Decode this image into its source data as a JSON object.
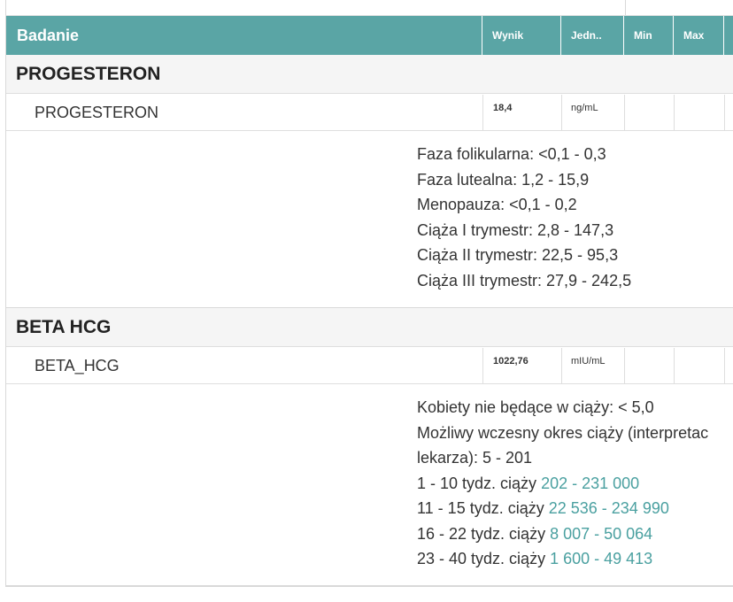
{
  "header": {
    "col_test": "Badanie",
    "col_result": "Wynik",
    "col_unit": "Jedn..",
    "col_min": "Min",
    "col_max": "Max"
  },
  "sections": [
    {
      "title": "PROGESTERON",
      "row": {
        "name": "PROGESTERON",
        "value": "18,4",
        "unit": "ng/mL"
      },
      "norms": [
        "Faza folikularna: <0,1 - 0,3",
        "Faza lutealna: 1,2 - 15,9",
        "Menopauza: <0,1 - 0,2",
        "Ciąża I trymestr: 2,8 - 147,3",
        "Ciąża II trymestr: 22,5 - 95,3",
        "Ciąża III trymestr: 27,9 - 242,5"
      ]
    },
    {
      "title": "BETA HCG",
      "row": {
        "name": "BETA_HCG",
        "value": "1022,76",
        "unit": "mIU/mL"
      },
      "norms": [
        "Kobiety nie będące w ciąży: < 5,0",
        "Możliwy wczesny okres ciąży (interpretac",
        "lekarza): 5 - 201"
      ],
      "norms_ranges": [
        {
          "label": "1 - 10 tydz. ciąży ",
          "range": "202 - 231 000"
        },
        {
          "label": "11 - 15 tydz. ciąży ",
          "range": "22 536 - 234 990"
        },
        {
          "label": "16 - 22 tydz. ciąży ",
          "range": "8 007 - 50 064"
        },
        {
          "label": "23 - 40 tydz. ciąży ",
          "range": "1 600 - 49 413"
        }
      ]
    }
  ],
  "colors": {
    "header_bg": "#5aa5a5",
    "range_text": "#4aa0a0"
  }
}
